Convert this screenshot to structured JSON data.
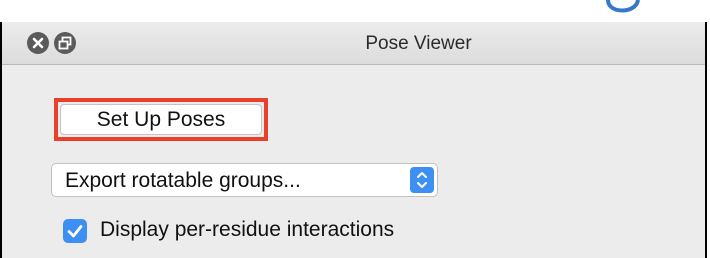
{
  "window": {
    "title": "Pose Viewer"
  },
  "main": {
    "setup_button_label": "Set Up Poses",
    "export_select_value": "Export rotatable groups...",
    "display_interactions_label": "Display per-residue interactions",
    "display_interactions_checked": true
  },
  "colors": {
    "accent": "#3d8ff2",
    "highlight": "#e8402b"
  },
  "icons": {
    "close": "close-icon",
    "float": "float-window-icon",
    "select_arrows": "chevron-up-down-icon",
    "check": "checkmark-icon"
  }
}
